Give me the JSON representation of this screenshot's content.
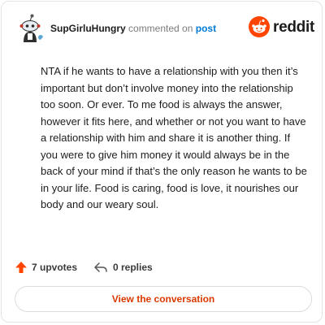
{
  "header": {
    "username": "SupGirluHungry",
    "commented_text": "commented on",
    "post_link": "post",
    "brand": "reddit"
  },
  "comment": {
    "text": "NTA if he wants to have a relationship with you then it’s important but don’t involve money into the relationship too soon. Or ever. To me food is always the answer, however it fits here, and whether or not you want to have a relationship with him and share it is another thing. If you were to give him money it would always be in the back of your mind if that’s the only reason he wants to be in your life. Food is caring, food is love, it nourishes our body and our weary soul."
  },
  "actions": {
    "upvotes": "7 upvotes",
    "replies": "0 replies"
  },
  "cta": {
    "label": "View the conversation"
  },
  "colors": {
    "brand_orange": "#ff4500",
    "link_blue": "#0079d3",
    "cta_text": "#d93900"
  },
  "icons": {
    "upvote": "upvote-arrow-icon",
    "reply": "reply-arrow-icon",
    "logo": "reddit-snoo-icon"
  }
}
